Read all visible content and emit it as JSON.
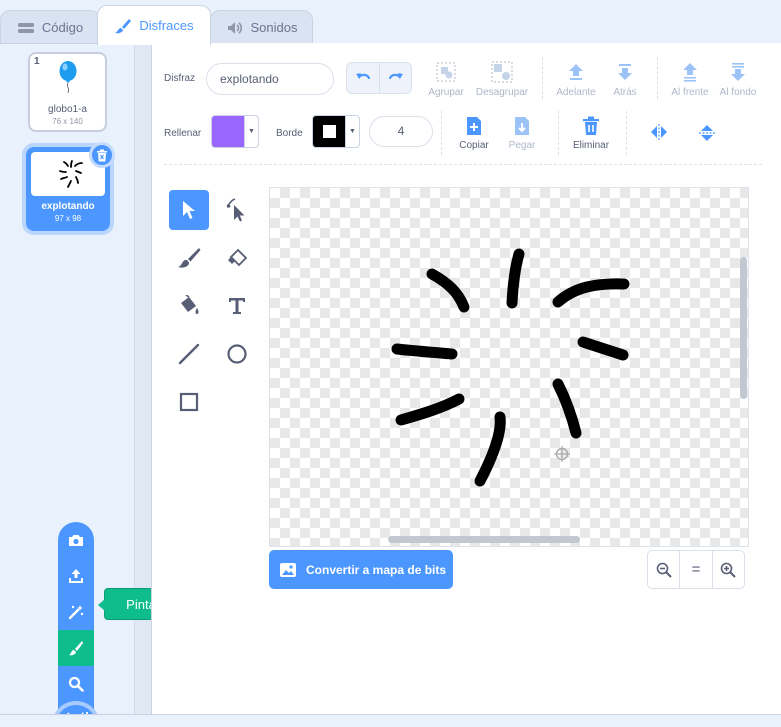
{
  "tabs": [
    {
      "label": "Código",
      "icon": "code-icon"
    },
    {
      "label": "Disfraces",
      "icon": "brush-icon"
    },
    {
      "label": "Sonidos",
      "icon": "speaker-icon"
    }
  ],
  "costumes": [
    {
      "num": "1",
      "name": "globo1-a",
      "size": "76 x 140"
    },
    {
      "num": "2",
      "name": "explotando",
      "size": "97 x 98"
    }
  ],
  "add_menu": {
    "items": [
      "camera-icon",
      "upload-icon",
      "surprise-icon",
      "paint-icon",
      "search-icon"
    ],
    "tooltip": "Pinta"
  },
  "toolbar": {
    "costume_label": "Disfraz",
    "costume_name": "explotando",
    "group": "Agrupar",
    "ungroup": "Desagrupar",
    "forward": "Adelante",
    "backward": "Atrás",
    "front": "Al frente",
    "back": "Al fondo",
    "fill_label": "Rellenar",
    "outline_label": "Borde",
    "outline_width": "4",
    "copy": "Copiar",
    "paste": "Pegar",
    "delete": "Eliminar"
  },
  "colors": {
    "accent": "#4c97ff",
    "fill": "#9966ff",
    "outline": "#000000",
    "paint_green": "#0fbd8c"
  },
  "convert_button": "Convertir a mapa de bits",
  "zoom": {
    "out": "zoom-out-icon",
    "reset": "=",
    "in": "zoom-in-icon"
  }
}
